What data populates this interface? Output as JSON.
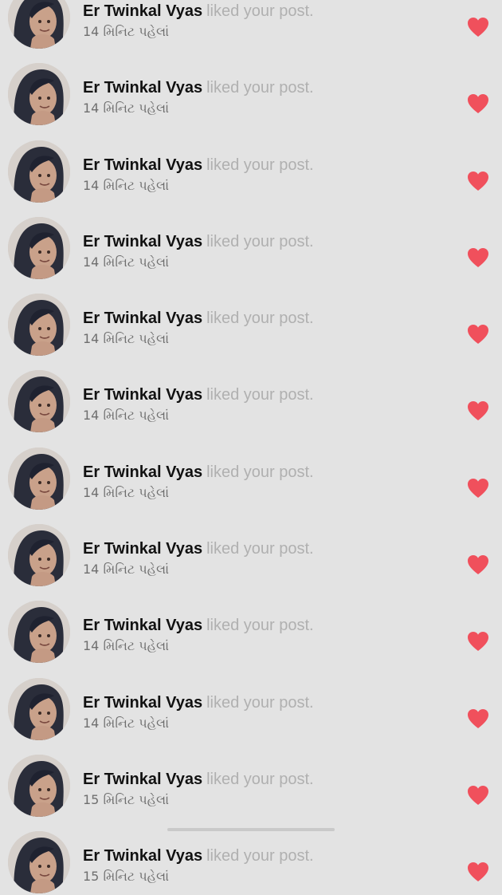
{
  "notifications": [
    {
      "name": "Er Twinkal Vyas",
      "action": "liked your post.",
      "time": "14 મિનિટ પહેલાં"
    },
    {
      "name": "Er Twinkal Vyas",
      "action": "liked your post.",
      "time": "14 મિનિટ પહેલાં"
    },
    {
      "name": "Er Twinkal Vyas",
      "action": "liked your post.",
      "time": "14 મિનિટ પહેલાં"
    },
    {
      "name": "Er Twinkal Vyas",
      "action": "liked your post.",
      "time": "14 મિનિટ પહેલાં"
    },
    {
      "name": "Er Twinkal Vyas",
      "action": "liked your post.",
      "time": "14 મિનિટ પહેલાં"
    },
    {
      "name": "Er Twinkal Vyas",
      "action": "liked your post.",
      "time": "14 મિનિટ પહેલાં"
    },
    {
      "name": "Er Twinkal Vyas",
      "action": "liked your post.",
      "time": "14 મિનિટ પહેલાં"
    },
    {
      "name": "Er Twinkal Vyas",
      "action": "liked your post.",
      "time": "14 મિનિટ પહેલાં"
    },
    {
      "name": "Er Twinkal Vyas",
      "action": "liked your post.",
      "time": "14 મિનિટ પહેલાં"
    },
    {
      "name": "Er Twinkal Vyas",
      "action": "liked your post.",
      "time": "14 મિનિટ પહેલાં"
    },
    {
      "name": "Er Twinkal Vyas",
      "action": "liked your post.",
      "time": "15 મિનિટ પહેલાં"
    },
    {
      "name": "Er Twinkal Vyas",
      "action": "liked your post.",
      "time": "15 મિનિટ પહેલાં"
    }
  ],
  "icons": {
    "avatar": "user-avatar",
    "heart": "heart-icon"
  },
  "colors": {
    "heart": "#f0505c",
    "name": "#111111",
    "action": "#b0b0b0",
    "time": "#6f6f6f",
    "background": "#e3e3e3"
  }
}
